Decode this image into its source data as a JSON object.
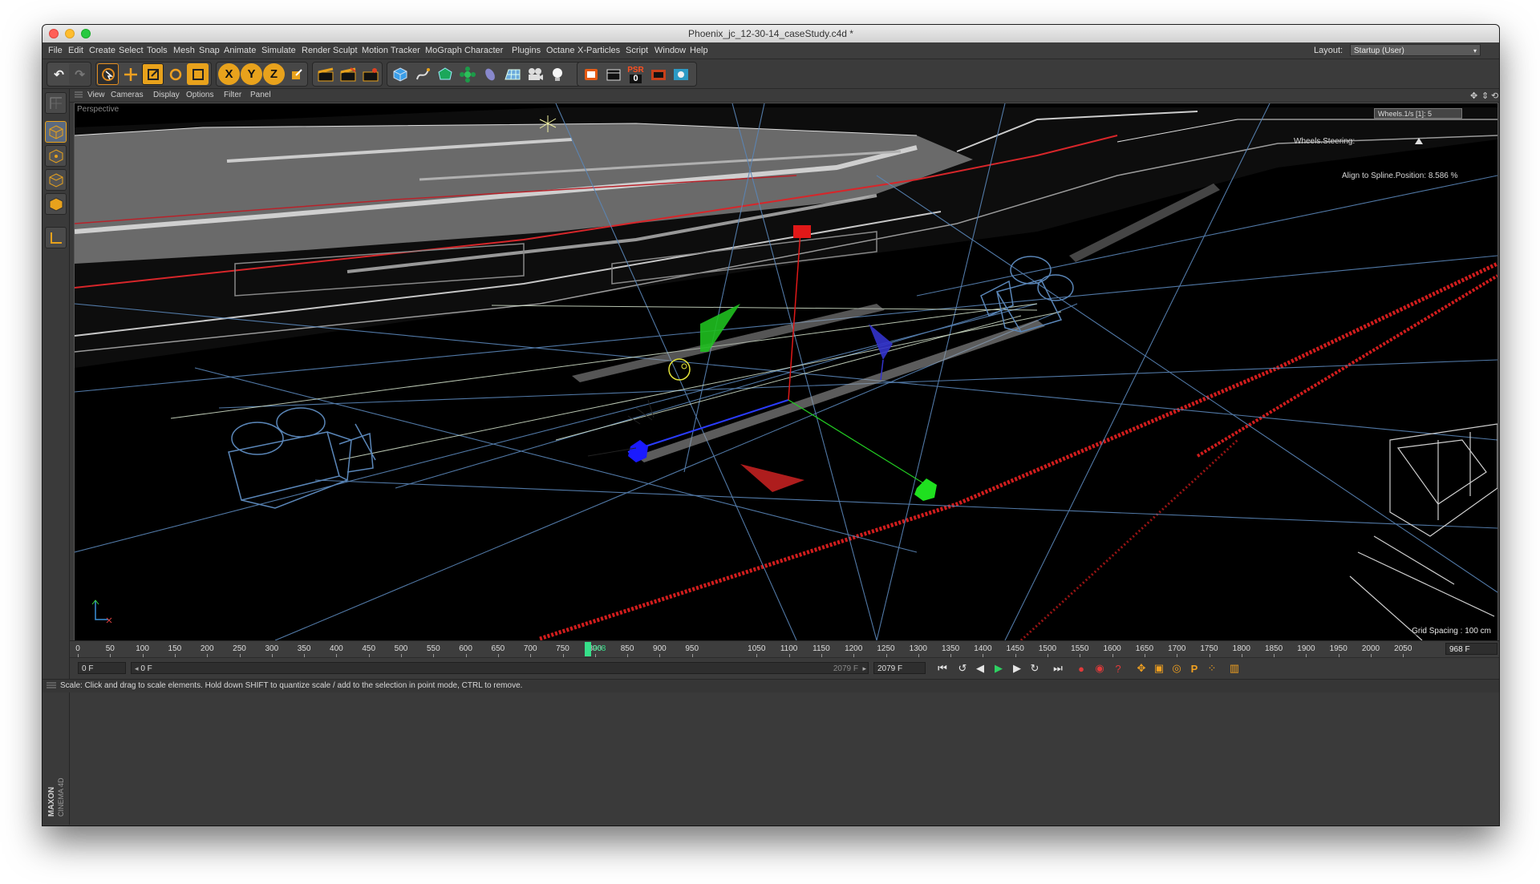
{
  "window": {
    "title": "Phoenix_jc_12-30-14_caseStudy.c4d *"
  },
  "menu": [
    "File",
    "Edit",
    "Create",
    "Select",
    "Tools",
    "Mesh",
    "Snap",
    "Animate",
    "Simulate",
    "Render",
    "Sculpt",
    "Motion Tracker",
    "MoGraph",
    "Character",
    "Plugins",
    "Octane",
    "X-Particles",
    "Script",
    "Window",
    "Help"
  ],
  "layout": {
    "label": "Layout:",
    "value": "Startup (User)"
  },
  "toolbar": {
    "psr_label": "PSR",
    "psr_value": "0",
    "axis_x": "X",
    "axis_y": "Y",
    "axis_z": "Z"
  },
  "viewmenu": [
    "View",
    "Cameras",
    "Display",
    "Options",
    "Filter",
    "Panel"
  ],
  "viewport": {
    "name": "Perspective",
    "hud_wheels": "Wheels.1/s [1]:  5",
    "hud_steering": "Wheels.Steering:",
    "hud_align": "Align to Spline.Position:   8.586 %",
    "grid_spacing": "Grid Spacing : 100 cm"
  },
  "timeline": {
    "labels": [
      "0",
      "50",
      "100",
      "150",
      "200",
      "250",
      "300",
      "350",
      "400",
      "450",
      "500",
      "550",
      "600",
      "650",
      "700",
      "750",
      "800",
      "850",
      "900",
      "950",
      "1000",
      "1050",
      "1100",
      "1150",
      "1200",
      "1250",
      "1300",
      "1350",
      "1400",
      "1450",
      "1500",
      "1550",
      "1600",
      "1650",
      "1700",
      "1750",
      "1800",
      "1850",
      "1900",
      "1950",
      "2000",
      "2050"
    ],
    "current": "968",
    "current_frame_box": "968 F"
  },
  "playback": {
    "start": "0 F",
    "range_start": "0 F",
    "range_end": "2079 F",
    "end": "2079 F"
  },
  "status": "Scale: Click and drag to scale elements. Hold down SHIFT to quantize scale / add to the selection in point mode, CTRL to remove.",
  "brand": {
    "maxon": "MAXON",
    "product": "CINEMA 4D"
  }
}
